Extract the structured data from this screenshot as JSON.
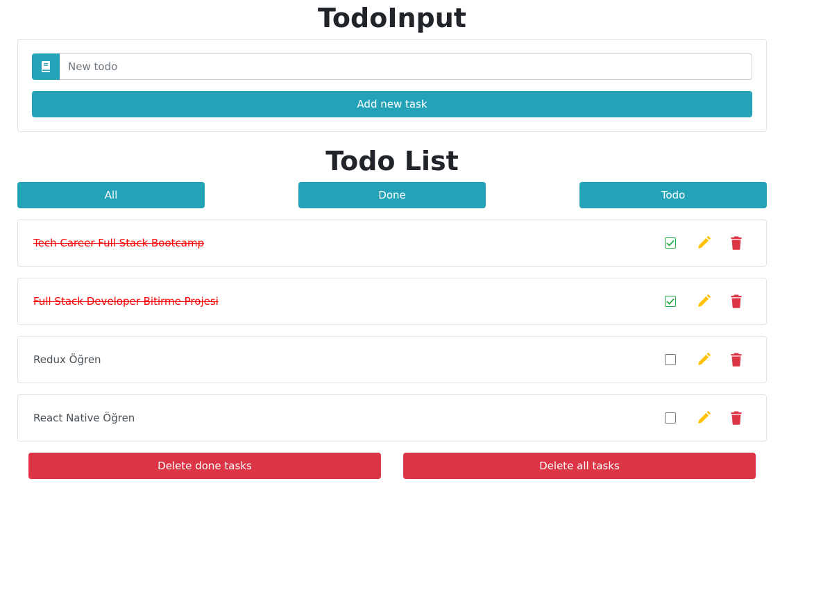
{
  "input_section": {
    "title": "TodoInput",
    "input_icon": "book-icon",
    "placeholder": "New todo",
    "value": "",
    "add_button_label": "Add new task"
  },
  "list_section": {
    "title": "Todo List",
    "filters": [
      {
        "label": "All"
      },
      {
        "label": "Done"
      },
      {
        "label": "Todo"
      }
    ],
    "todos": [
      {
        "text": "Tech Career Full Stack Bootcamp",
        "done": true
      },
      {
        "text": "Full Stack Developer Bitirme Projesi",
        "done": true
      },
      {
        "text": "Redux Öğren",
        "done": false
      },
      {
        "text": "React Native Öğren",
        "done": false
      }
    ],
    "item_icons": {
      "check": "checkbox-icon",
      "edit": "pencil-icon",
      "delete": "trash-icon"
    },
    "delete_done_label": "Delete done tasks",
    "delete_all_label": "Delete all tasks"
  },
  "colors": {
    "info": "#23a2b8",
    "danger": "#dc3545",
    "warning": "#ffc107",
    "success": "#28a745",
    "done_text": "#ff0000"
  }
}
